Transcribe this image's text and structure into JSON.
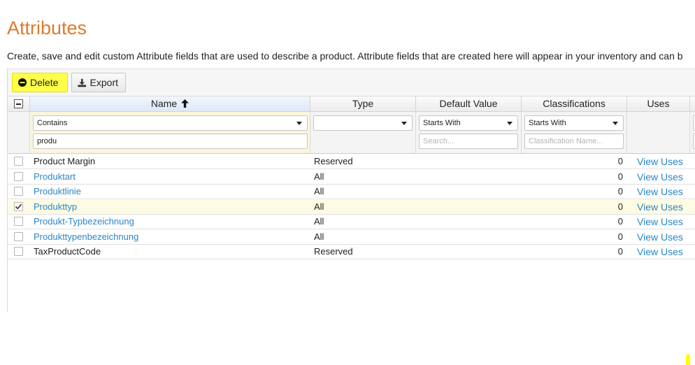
{
  "page": {
    "title": "Attributes",
    "description": "Create, save and edit custom Attribute fields that are used to describe a product. Attribute fields that are created here will appear in your inventory and can b"
  },
  "toolbar": {
    "delete_label": "Delete",
    "export_label": "Export"
  },
  "columns": {
    "name": "Name",
    "type": "Type",
    "default_value": "Default Value",
    "classifications": "Classifications",
    "uses": "Uses"
  },
  "filters": {
    "name_operator": "Contains",
    "name_value": "produ",
    "type_value": "",
    "default_operator": "Starts With",
    "default_placeholder": "Search...",
    "class_operator": "Starts With",
    "class_placeholder": "Classification Name..."
  },
  "rows": [
    {
      "name": "Product Margin",
      "type": "Reserved",
      "classifications": "0",
      "uses": "View Uses",
      "checked": false,
      "link": false
    },
    {
      "name": "Produktart",
      "type": "All",
      "classifications": "0",
      "uses": "View Uses",
      "checked": false,
      "link": true
    },
    {
      "name": "Produktlinie",
      "type": "All",
      "classifications": "0",
      "uses": "View Uses",
      "checked": false,
      "link": true
    },
    {
      "name": "Produkttyp",
      "type": "All",
      "classifications": "0",
      "uses": "View Uses",
      "checked": true,
      "link": true
    },
    {
      "name": "Produkt-Typbezeichnung",
      "type": "All",
      "classifications": "0",
      "uses": "View Uses",
      "checked": false,
      "link": true
    },
    {
      "name": "Produkttypenbezeichnung",
      "type": "All",
      "classifications": "0",
      "uses": "View Uses",
      "checked": false,
      "link": true
    },
    {
      "name": "TaxProductCode",
      "type": "Reserved",
      "classifications": "0",
      "uses": "View Uses",
      "checked": false,
      "link": false
    }
  ],
  "colors": {
    "title": "#e07a2c",
    "link": "#2a86c7",
    "highlight": "#ffff4a",
    "selected_row": "#fdfbe3"
  }
}
